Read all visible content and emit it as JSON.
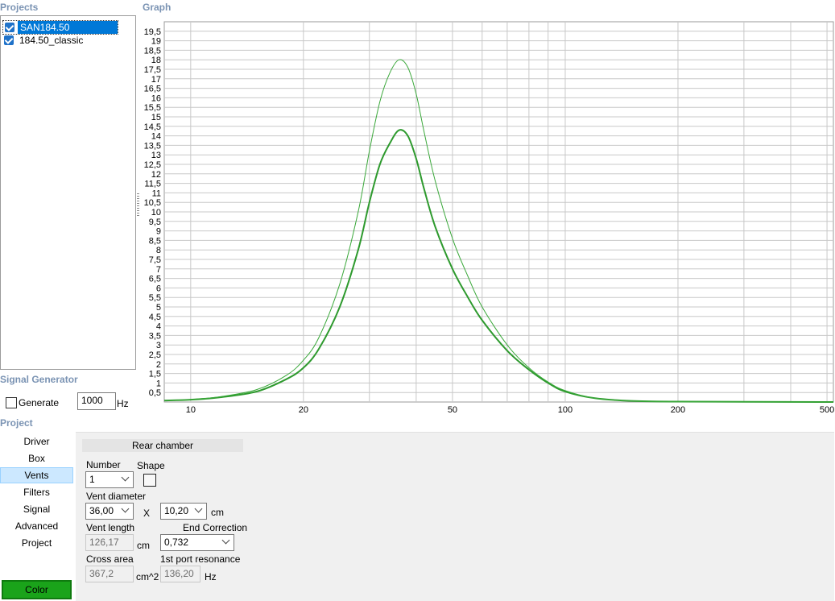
{
  "projects": {
    "title": "Projects",
    "items": [
      {
        "label": "SAN184.50",
        "checked": true,
        "selected": true
      },
      {
        "label": "184.50_classic",
        "checked": true,
        "selected": false
      }
    ]
  },
  "graph": {
    "title": "Graph"
  },
  "signal_generator": {
    "title": "Signal Generator",
    "generate_label": "Generate",
    "generate_checked": false,
    "frequency_value": "1000",
    "frequency_unit": "Hz"
  },
  "project_section": {
    "title": "Project",
    "nav": [
      "Driver",
      "Box",
      "Vents",
      "Filters",
      "Signal",
      "Advanced",
      "Project"
    ],
    "active_nav": "Vents",
    "color_button": "Color",
    "color_button_hex": "#1aa31a"
  },
  "vents": {
    "header": "Rear chamber",
    "number_label": "Number",
    "number_value": "1",
    "shape_label": "Shape",
    "diameter_label": "Vent diameter",
    "diameter_value": "36,00",
    "x_label": "X",
    "width_value": "10,20",
    "cm_unit": "cm",
    "length_label": "Vent length",
    "length_value": "126,17",
    "length_unit": "cm",
    "end_correction_label": "End Correction",
    "end_correction_value": "0,732",
    "cross_area_label": "Cross area",
    "cross_area_value": "367,2",
    "cross_area_unit": "cm^2",
    "port_resonance_label": "1st port resonance",
    "port_resonance_value": "136,20",
    "port_resonance_unit": "Hz"
  },
  "chart_data": {
    "type": "line",
    "x_scale": "log",
    "xlim": [
      8.5,
      520
    ],
    "ylim": [
      0,
      20
    ],
    "x_ticks": [
      10,
      20,
      50,
      100,
      200,
      500
    ],
    "x_tick_labels": [
      "10",
      "20",
      "50",
      "100",
      "200",
      "500"
    ],
    "y_ticks": [
      0.5,
      1,
      1.5,
      2,
      2.5,
      3,
      3.5,
      4,
      4.5,
      5,
      5.5,
      6,
      6.5,
      7,
      7.5,
      8,
      8.5,
      9,
      9.5,
      10,
      10.5,
      11,
      11.5,
      12,
      12.5,
      13,
      13.5,
      14,
      14.5,
      15,
      15.5,
      16,
      16.5,
      17,
      17.5,
      18,
      18.5,
      19,
      19.5
    ],
    "y_tick_labels": [
      "0,5",
      "1",
      "1,5",
      "2",
      "2,5",
      "3",
      "3,5",
      "4",
      "4,5",
      "5",
      "5,5",
      "6",
      "6,5",
      "7",
      "7,5",
      "8",
      "8,5",
      "9",
      "9,5",
      "10",
      "10,5",
      "11",
      "11,5",
      "12",
      "12,5",
      "13",
      "13,5",
      "14",
      "14,5",
      "15",
      "15,5",
      "16",
      "16,5",
      "17",
      "17,5",
      "18",
      "18,5",
      "19",
      "19,5"
    ],
    "grid": true,
    "series_colors": [
      "#2e9a2e",
      "#3aa83a"
    ],
    "series": [
      {
        "x": [
          8.5,
          10,
          12,
          15,
          18,
          20,
          22,
          25,
          28,
          30,
          32,
          34,
          36,
          38,
          40,
          42,
          45,
          50,
          55,
          60,
          70,
          80,
          90,
          100,
          120,
          150,
          200,
          300,
          520
        ],
        "y": [
          0.08,
          0.12,
          0.25,
          0.55,
          1.2,
          1.8,
          2.8,
          5.0,
          8.0,
          10.5,
          12.5,
          13.6,
          14.3,
          14.0,
          12.8,
          11.2,
          9.2,
          7.0,
          5.5,
          4.3,
          2.7,
          1.7,
          1.0,
          0.55,
          0.2,
          0.06,
          0.02,
          0.01,
          0.0
        ]
      },
      {
        "x": [
          8.5,
          10,
          12,
          15,
          18,
          20,
          22,
          25,
          28,
          30,
          32,
          34,
          36,
          38,
          40,
          42,
          45,
          50,
          55,
          60,
          70,
          80,
          90,
          100,
          120,
          150,
          200,
          300,
          520
        ],
        "y": [
          0.08,
          0.13,
          0.28,
          0.65,
          1.4,
          2.2,
          3.4,
          6.2,
          10.0,
          13.2,
          15.8,
          17.3,
          18.0,
          17.6,
          16.2,
          14.2,
          11.6,
          8.6,
          6.6,
          5.0,
          3.0,
          1.8,
          1.05,
          0.6,
          0.2,
          0.06,
          0.02,
          0.01,
          0.0
        ]
      }
    ]
  }
}
